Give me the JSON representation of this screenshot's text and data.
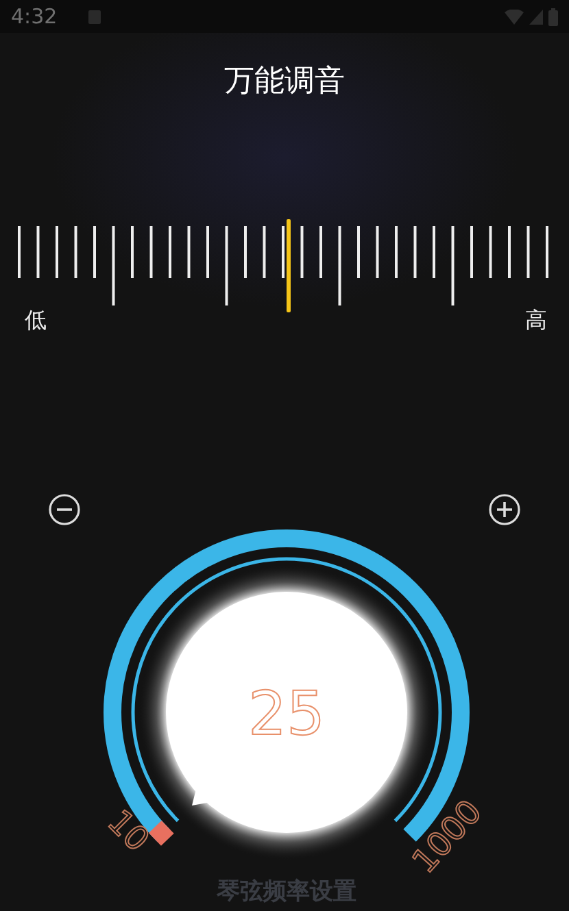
{
  "status_bar": {
    "time": "4:32"
  },
  "title": "万能调音",
  "scale": {
    "low_label": "低",
    "high_label": "高"
  },
  "dial": {
    "value": "25",
    "min_label": "10",
    "max_label": "1000",
    "caption": "琴弦频率设置"
  }
}
